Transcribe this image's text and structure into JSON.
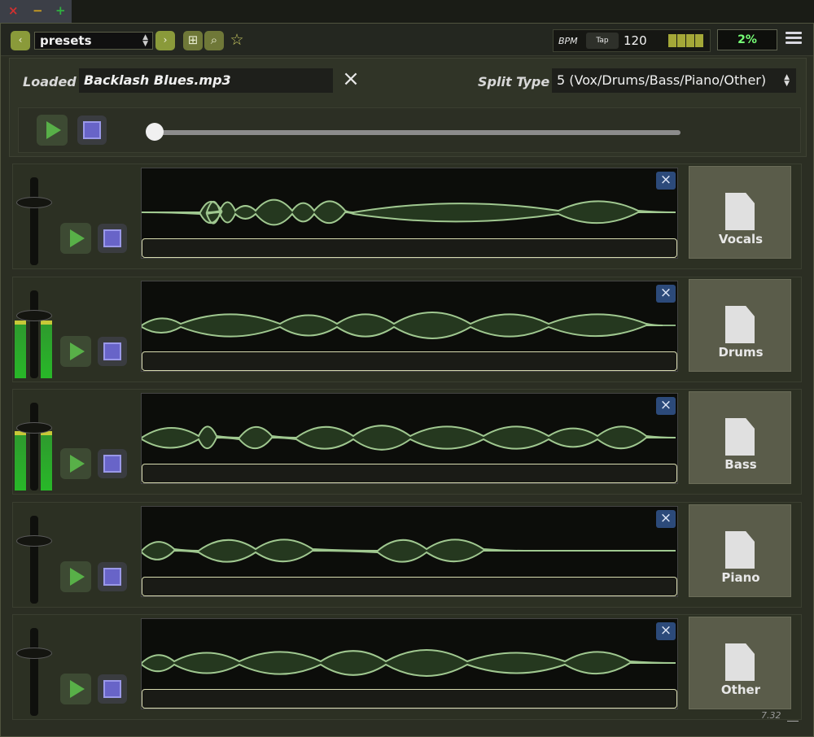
{
  "titlebar": {
    "close": "×",
    "minimize": "−",
    "maximize": "+"
  },
  "toolbar": {
    "prev": "‹",
    "next": "›",
    "preset": "presets",
    "add_icon": "⊞",
    "search_icon": "⌕",
    "star_icon": "☆",
    "bpm_label": "BPM",
    "tap_label": "Tap",
    "bpm_value": "120",
    "percent": "2%"
  },
  "loaded": {
    "label": "Loaded",
    "filename": "Backlash Blues.mp3",
    "clear_icon": "×",
    "split_label": "Split Type",
    "split_value": "5 (Vox/Drums/Bass/Piano/Other)"
  },
  "transport": {
    "progress": 0.0
  },
  "stems": [
    {
      "name": "Vocals",
      "mute": "×",
      "fader_level": 0.22,
      "meter_level": 0.0
    },
    {
      "name": "Drums",
      "mute": "×",
      "fader_level": 0.22,
      "meter_level": 0.66
    },
    {
      "name": "Bass",
      "mute": "×",
      "fader_level": 0.22,
      "meter_level": 0.68
    },
    {
      "name": "Piano",
      "mute": "×",
      "fader_level": 0.22,
      "meter_level": 0.0
    },
    {
      "name": "Other",
      "mute": "×",
      "fader_level": 0.22,
      "meter_level": 0.0
    }
  ],
  "footer": {
    "version": "7.32"
  },
  "colors": {
    "accent_green": "#58b048",
    "stop_purple": "#6864c8",
    "percent_green": "#76ff76",
    "mute_blue": "#2c4a7a"
  }
}
